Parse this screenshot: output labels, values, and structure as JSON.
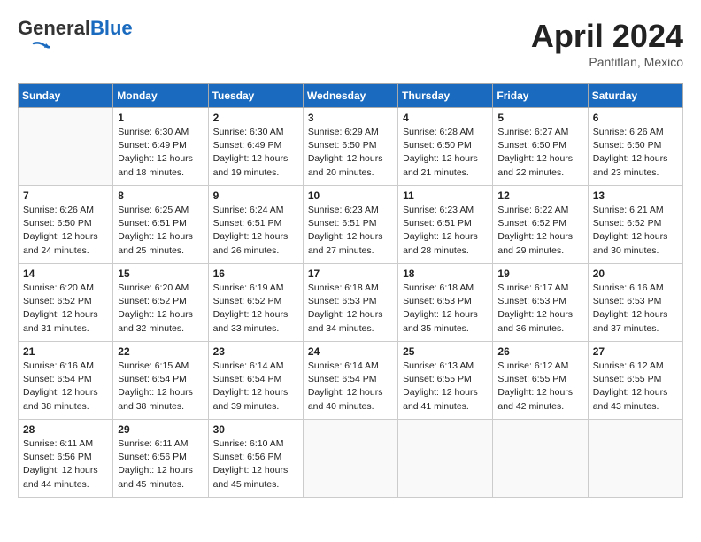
{
  "header": {
    "logo_general": "General",
    "logo_blue": "Blue",
    "title": "April 2024",
    "location": "Pantitlan, Mexico"
  },
  "columns": [
    "Sunday",
    "Monday",
    "Tuesday",
    "Wednesday",
    "Thursday",
    "Friday",
    "Saturday"
  ],
  "weeks": [
    [
      {
        "day": "",
        "text": ""
      },
      {
        "day": "1",
        "text": "Sunrise: 6:30 AM\nSunset: 6:49 PM\nDaylight: 12 hours\nand 18 minutes."
      },
      {
        "day": "2",
        "text": "Sunrise: 6:30 AM\nSunset: 6:49 PM\nDaylight: 12 hours\nand 19 minutes."
      },
      {
        "day": "3",
        "text": "Sunrise: 6:29 AM\nSunset: 6:50 PM\nDaylight: 12 hours\nand 20 minutes."
      },
      {
        "day": "4",
        "text": "Sunrise: 6:28 AM\nSunset: 6:50 PM\nDaylight: 12 hours\nand 21 minutes."
      },
      {
        "day": "5",
        "text": "Sunrise: 6:27 AM\nSunset: 6:50 PM\nDaylight: 12 hours\nand 22 minutes."
      },
      {
        "day": "6",
        "text": "Sunrise: 6:26 AM\nSunset: 6:50 PM\nDaylight: 12 hours\nand 23 minutes."
      }
    ],
    [
      {
        "day": "7",
        "text": "Sunrise: 6:26 AM\nSunset: 6:50 PM\nDaylight: 12 hours\nand 24 minutes."
      },
      {
        "day": "8",
        "text": "Sunrise: 6:25 AM\nSunset: 6:51 PM\nDaylight: 12 hours\nand 25 minutes."
      },
      {
        "day": "9",
        "text": "Sunrise: 6:24 AM\nSunset: 6:51 PM\nDaylight: 12 hours\nand 26 minutes."
      },
      {
        "day": "10",
        "text": "Sunrise: 6:23 AM\nSunset: 6:51 PM\nDaylight: 12 hours\nand 27 minutes."
      },
      {
        "day": "11",
        "text": "Sunrise: 6:23 AM\nSunset: 6:51 PM\nDaylight: 12 hours\nand 28 minutes."
      },
      {
        "day": "12",
        "text": "Sunrise: 6:22 AM\nSunset: 6:52 PM\nDaylight: 12 hours\nand 29 minutes."
      },
      {
        "day": "13",
        "text": "Sunrise: 6:21 AM\nSunset: 6:52 PM\nDaylight: 12 hours\nand 30 minutes."
      }
    ],
    [
      {
        "day": "14",
        "text": "Sunrise: 6:20 AM\nSunset: 6:52 PM\nDaylight: 12 hours\nand 31 minutes."
      },
      {
        "day": "15",
        "text": "Sunrise: 6:20 AM\nSunset: 6:52 PM\nDaylight: 12 hours\nand 32 minutes."
      },
      {
        "day": "16",
        "text": "Sunrise: 6:19 AM\nSunset: 6:52 PM\nDaylight: 12 hours\nand 33 minutes."
      },
      {
        "day": "17",
        "text": "Sunrise: 6:18 AM\nSunset: 6:53 PM\nDaylight: 12 hours\nand 34 minutes."
      },
      {
        "day": "18",
        "text": "Sunrise: 6:18 AM\nSunset: 6:53 PM\nDaylight: 12 hours\nand 35 minutes."
      },
      {
        "day": "19",
        "text": "Sunrise: 6:17 AM\nSunset: 6:53 PM\nDaylight: 12 hours\nand 36 minutes."
      },
      {
        "day": "20",
        "text": "Sunrise: 6:16 AM\nSunset: 6:53 PM\nDaylight: 12 hours\nand 37 minutes."
      }
    ],
    [
      {
        "day": "21",
        "text": "Sunrise: 6:16 AM\nSunset: 6:54 PM\nDaylight: 12 hours\nand 38 minutes."
      },
      {
        "day": "22",
        "text": "Sunrise: 6:15 AM\nSunset: 6:54 PM\nDaylight: 12 hours\nand 38 minutes."
      },
      {
        "day": "23",
        "text": "Sunrise: 6:14 AM\nSunset: 6:54 PM\nDaylight: 12 hours\nand 39 minutes."
      },
      {
        "day": "24",
        "text": "Sunrise: 6:14 AM\nSunset: 6:54 PM\nDaylight: 12 hours\nand 40 minutes."
      },
      {
        "day": "25",
        "text": "Sunrise: 6:13 AM\nSunset: 6:55 PM\nDaylight: 12 hours\nand 41 minutes."
      },
      {
        "day": "26",
        "text": "Sunrise: 6:12 AM\nSunset: 6:55 PM\nDaylight: 12 hours\nand 42 minutes."
      },
      {
        "day": "27",
        "text": "Sunrise: 6:12 AM\nSunset: 6:55 PM\nDaylight: 12 hours\nand 43 minutes."
      }
    ],
    [
      {
        "day": "28",
        "text": "Sunrise: 6:11 AM\nSunset: 6:56 PM\nDaylight: 12 hours\nand 44 minutes."
      },
      {
        "day": "29",
        "text": "Sunrise: 6:11 AM\nSunset: 6:56 PM\nDaylight: 12 hours\nand 45 minutes."
      },
      {
        "day": "30",
        "text": "Sunrise: 6:10 AM\nSunset: 6:56 PM\nDaylight: 12 hours\nand 45 minutes."
      },
      {
        "day": "",
        "text": ""
      },
      {
        "day": "",
        "text": ""
      },
      {
        "day": "",
        "text": ""
      },
      {
        "day": "",
        "text": ""
      }
    ]
  ]
}
